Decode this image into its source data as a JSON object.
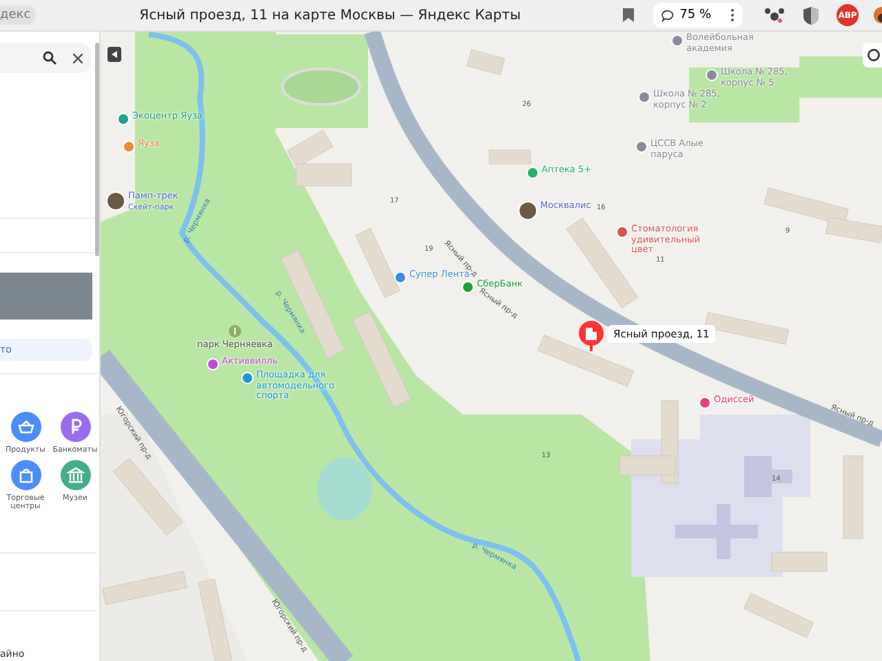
{
  "browser": {
    "tab_text": "декс",
    "title": "Ясный проезд, 11 на карте Москвы — Яндекс Карты",
    "zoom": "75 %",
    "extension_badge": "ABP"
  },
  "sidebar": {
    "link": "то",
    "categories": [
      {
        "label": "Продукты",
        "color": "#4c8ef7"
      },
      {
        "label": "Банкоматы",
        "color": "#9b6cf0"
      },
      {
        "label": "Торговые центры",
        "color": "#4c8ef7"
      },
      {
        "label": "Музеи",
        "color": "#46ad8a"
      }
    ],
    "footer_text": "айно"
  },
  "map": {
    "places": [
      {
        "kind": "icon",
        "name": "Экоцентр Яуза",
        "color": "#1fa38c"
      },
      {
        "kind": "icon",
        "name": "Яуза",
        "color": "#f08a3a"
      },
      {
        "kind": "photo",
        "name": "Памп-трек",
        "note": "Скейт-парк"
      },
      {
        "kind": "icon",
        "name": "Волейбольная академия",
        "color": "#8a8a9a"
      },
      {
        "kind": "icon",
        "name": "Школа № 285, корпус № 5",
        "color": "#8a8a9a"
      },
      {
        "kind": "icon",
        "name": "Школа № 285, корпус № 2",
        "color": "#8a8a9a"
      },
      {
        "kind": "icon",
        "name": "ЦССВ Алые паруса",
        "color": "#8a8a9a"
      },
      {
        "kind": "icon",
        "name": "Аптека 5+",
        "color": "#25b26a"
      },
      {
        "kind": "photo",
        "name": "Москвалис"
      },
      {
        "kind": "icon",
        "name": "Стоматология удивительный цвет",
        "color": "#e05252"
      },
      {
        "kind": "icon",
        "name": "Супер Лента",
        "color": "#3b8ee0"
      },
      {
        "kind": "icon",
        "name": "СберБанк",
        "color": "#21a038"
      },
      {
        "kind": "park",
        "name": "парк Черняевка"
      },
      {
        "kind": "icon",
        "name": "Активвилль",
        "color": "#c24bd6"
      },
      {
        "kind": "icon",
        "name": "Площадка для автомодельного спорта",
        "color": "#1b9ad0"
      },
      {
        "kind": "icon",
        "name": "Одиссей",
        "color": "#e5407f"
      }
    ],
    "streets": [
      {
        "name": "Ясный пр-д"
      },
      {
        "name": "Ясный пр-д"
      },
      {
        "name": "Ясный пр-д"
      },
      {
        "name": "Югорский пр-д"
      },
      {
        "name": "Югорский пр-д"
      },
      {
        "name": "р. Чермянка"
      },
      {
        "name": "р. Чермянка"
      },
      {
        "name": "р. Чермянка"
      }
    ],
    "houses": [
      "26",
      "11",
      "19",
      "17",
      "14",
      "9",
      "16",
      "13"
    ],
    "marker": {
      "label": "Ясный проезд, 11"
    }
  }
}
